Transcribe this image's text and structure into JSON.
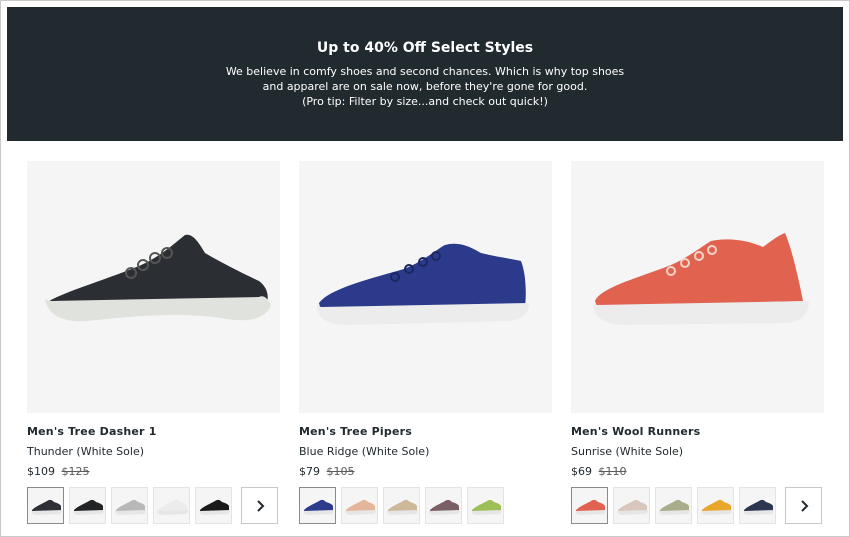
{
  "banner": {
    "title": "Up to 40% Off Select Styles",
    "line1": "We believe in comfy shoes and second chances. Which is why top shoes and apparel are on sale now, before they're gone for good.",
    "line2": "(Pro tip: Filter by size...and check out quick!)",
    "background_color": "#212a2f"
  },
  "products": [
    {
      "name": "Men's Tree Dasher 1",
      "color": "Thunder (White Sole)",
      "price": "$109",
      "old_price": "$125",
      "shoe_color": "#2b2e33",
      "sole_color": "#dfe2dd",
      "swatches": [
        "#2e3035",
        "#222324",
        "#b8b8b8",
        "#ececec",
        "#1a1a1a"
      ],
      "has_next": true
    },
    {
      "name": "Men's Tree Pipers",
      "color": "Blue Ridge (White Sole)",
      "price": "$79",
      "old_price": "$105",
      "shoe_color": "#2c3a8c",
      "sole_color": "#ececec",
      "swatches": [
        "#2c3a8c",
        "#e6b69a",
        "#cdb99a",
        "#7a6066",
        "#9cbf56"
      ],
      "has_next": false
    },
    {
      "name": "Men's Wool Runners",
      "color": "Sunrise (White Sole)",
      "price": "$69",
      "old_price": "$110",
      "shoe_color": "#e0624f",
      "sole_color": "#ececec",
      "swatches": [
        "#e0624f",
        "#d9c6bd",
        "#a9ad8a",
        "#e8a62a",
        "#2c3552"
      ],
      "has_next": true
    }
  ],
  "next_icon": "chevron-right-icon"
}
